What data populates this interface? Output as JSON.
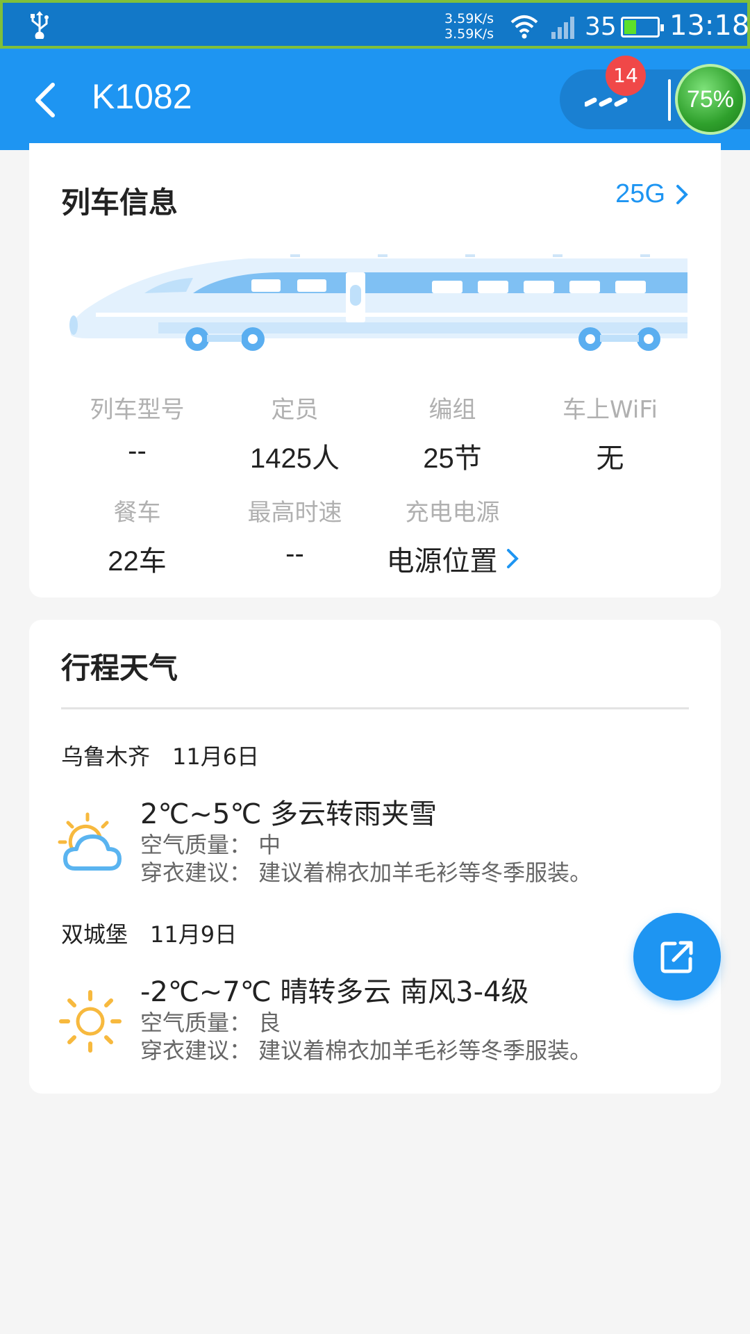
{
  "status_bar": {
    "net_up": "3.59K/s",
    "net_down": "3.59K/s",
    "signal_strength": "35",
    "battery_level": 0.34,
    "time": "13:18"
  },
  "header": {
    "title": "K1082",
    "notification_count": "14",
    "boost_label": "75%"
  },
  "train_info": {
    "title": "列车信息",
    "model_link": "25G",
    "items": [
      {
        "label": "列车型号",
        "value": "--"
      },
      {
        "label": "定员",
        "value": "1425人"
      },
      {
        "label": "编组",
        "value": "25节"
      },
      {
        "label": "车上WiFi",
        "value": "无"
      },
      {
        "label": "餐车",
        "value": "22车"
      },
      {
        "label": "最高时速",
        "value": "--"
      },
      {
        "label": "充电电源",
        "value": "电源位置"
      }
    ]
  },
  "weather": {
    "title": "行程天气",
    "stops": [
      {
        "city_date": "乌鲁木齐　11月6日",
        "summary": "2℃~5℃ 多云转雨夹雪",
        "air_quality": "空气质量：  中",
        "clothing": "穿衣建议：  建议着棉衣加羊毛衫等冬季服装。",
        "icon": "partly-cloudy-icon"
      },
      {
        "city_date": "双城堡　11月9日",
        "summary": "-2℃~7℃ 晴转多云 南风3-4级",
        "air_quality": "空气质量：  良",
        "clothing": "穿衣建议：  建议着棉衣加羊毛衫等冬季服装。",
        "icon": "sunny-icon"
      }
    ]
  },
  "colors": {
    "accent": "#1e95f2",
    "status_bar": "#1278c8",
    "badge": "#f04848"
  }
}
